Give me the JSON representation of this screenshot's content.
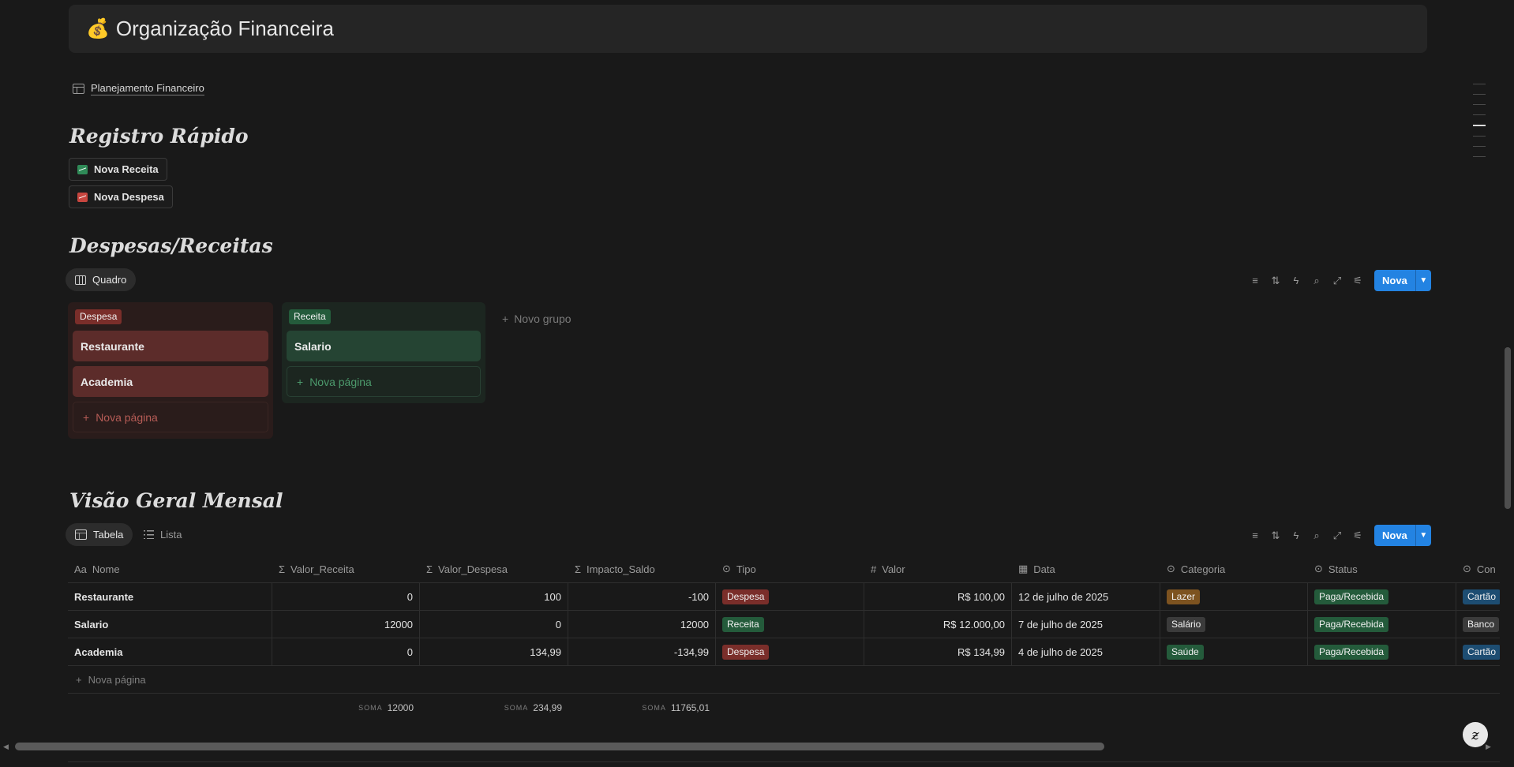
{
  "header": {
    "emoji": "💰",
    "title": "Organização Financeira"
  },
  "linked_page": {
    "label": "Planejamento Financeiro"
  },
  "quick_register": {
    "heading": "Registro Rápido",
    "buttons": [
      {
        "label": "Nova Receita"
      },
      {
        "label": "Nova Despesa"
      }
    ]
  },
  "board_section": {
    "heading": "Despesas/Receitas",
    "view_tab": "Quadro",
    "new_button": "Nova",
    "columns": [
      {
        "tag": "Despesa",
        "cards": [
          "Restaurante",
          "Academia"
        ],
        "new_page": "Nova página"
      },
      {
        "tag": "Receita",
        "cards": [
          "Salario"
        ],
        "new_page": "Nova página"
      }
    ],
    "new_group": "Novo grupo"
  },
  "table_section": {
    "heading": "Visão Geral Mensal",
    "tabs": [
      "Tabela",
      "Lista"
    ],
    "new_button": "Nova",
    "columns": [
      "Nome",
      "Valor_Receita",
      "Valor_Despesa",
      "Impacto_Saldo",
      "Tipo",
      "Valor",
      "Data",
      "Categoria",
      "Status",
      "Con"
    ],
    "rows": [
      {
        "nome": "Restaurante",
        "valor_receita": "0",
        "valor_despesa": "100",
        "impacto_saldo": "-100",
        "tipo": "Despesa",
        "valor": "R$ 100,00",
        "data": "12 de julho de 2025",
        "categoria": "Lazer",
        "status": "Paga/Recebida",
        "con": "Cartão"
      },
      {
        "nome": "Salario",
        "valor_receita": "12000",
        "valor_despesa": "0",
        "impacto_saldo": "12000",
        "tipo": "Receita",
        "valor": "R$ 12.000,00",
        "data": "7 de julho de 2025",
        "categoria": "Salário",
        "status": "Paga/Recebida",
        "con": "Banco"
      },
      {
        "nome": "Academia",
        "valor_receita": "0",
        "valor_despesa": "134,99",
        "impacto_saldo": "-134,99",
        "tipo": "Despesa",
        "valor": "R$ 134,99",
        "data": "4 de julho de 2025",
        "categoria": "Saúde",
        "status": "Paga/Recebida",
        "con": "Cartão"
      }
    ],
    "new_page": "Nova página",
    "sums": {
      "label": "SOMA",
      "valor_receita": "12000",
      "valor_despesa": "234,99",
      "impacto_saldo": "11765,01"
    }
  },
  "colors": {
    "accent": "#2383e2",
    "despesa": "#7a2e2a",
    "receita": "#245b3b",
    "lazer": "#7d5320",
    "status": "#245b3b"
  }
}
